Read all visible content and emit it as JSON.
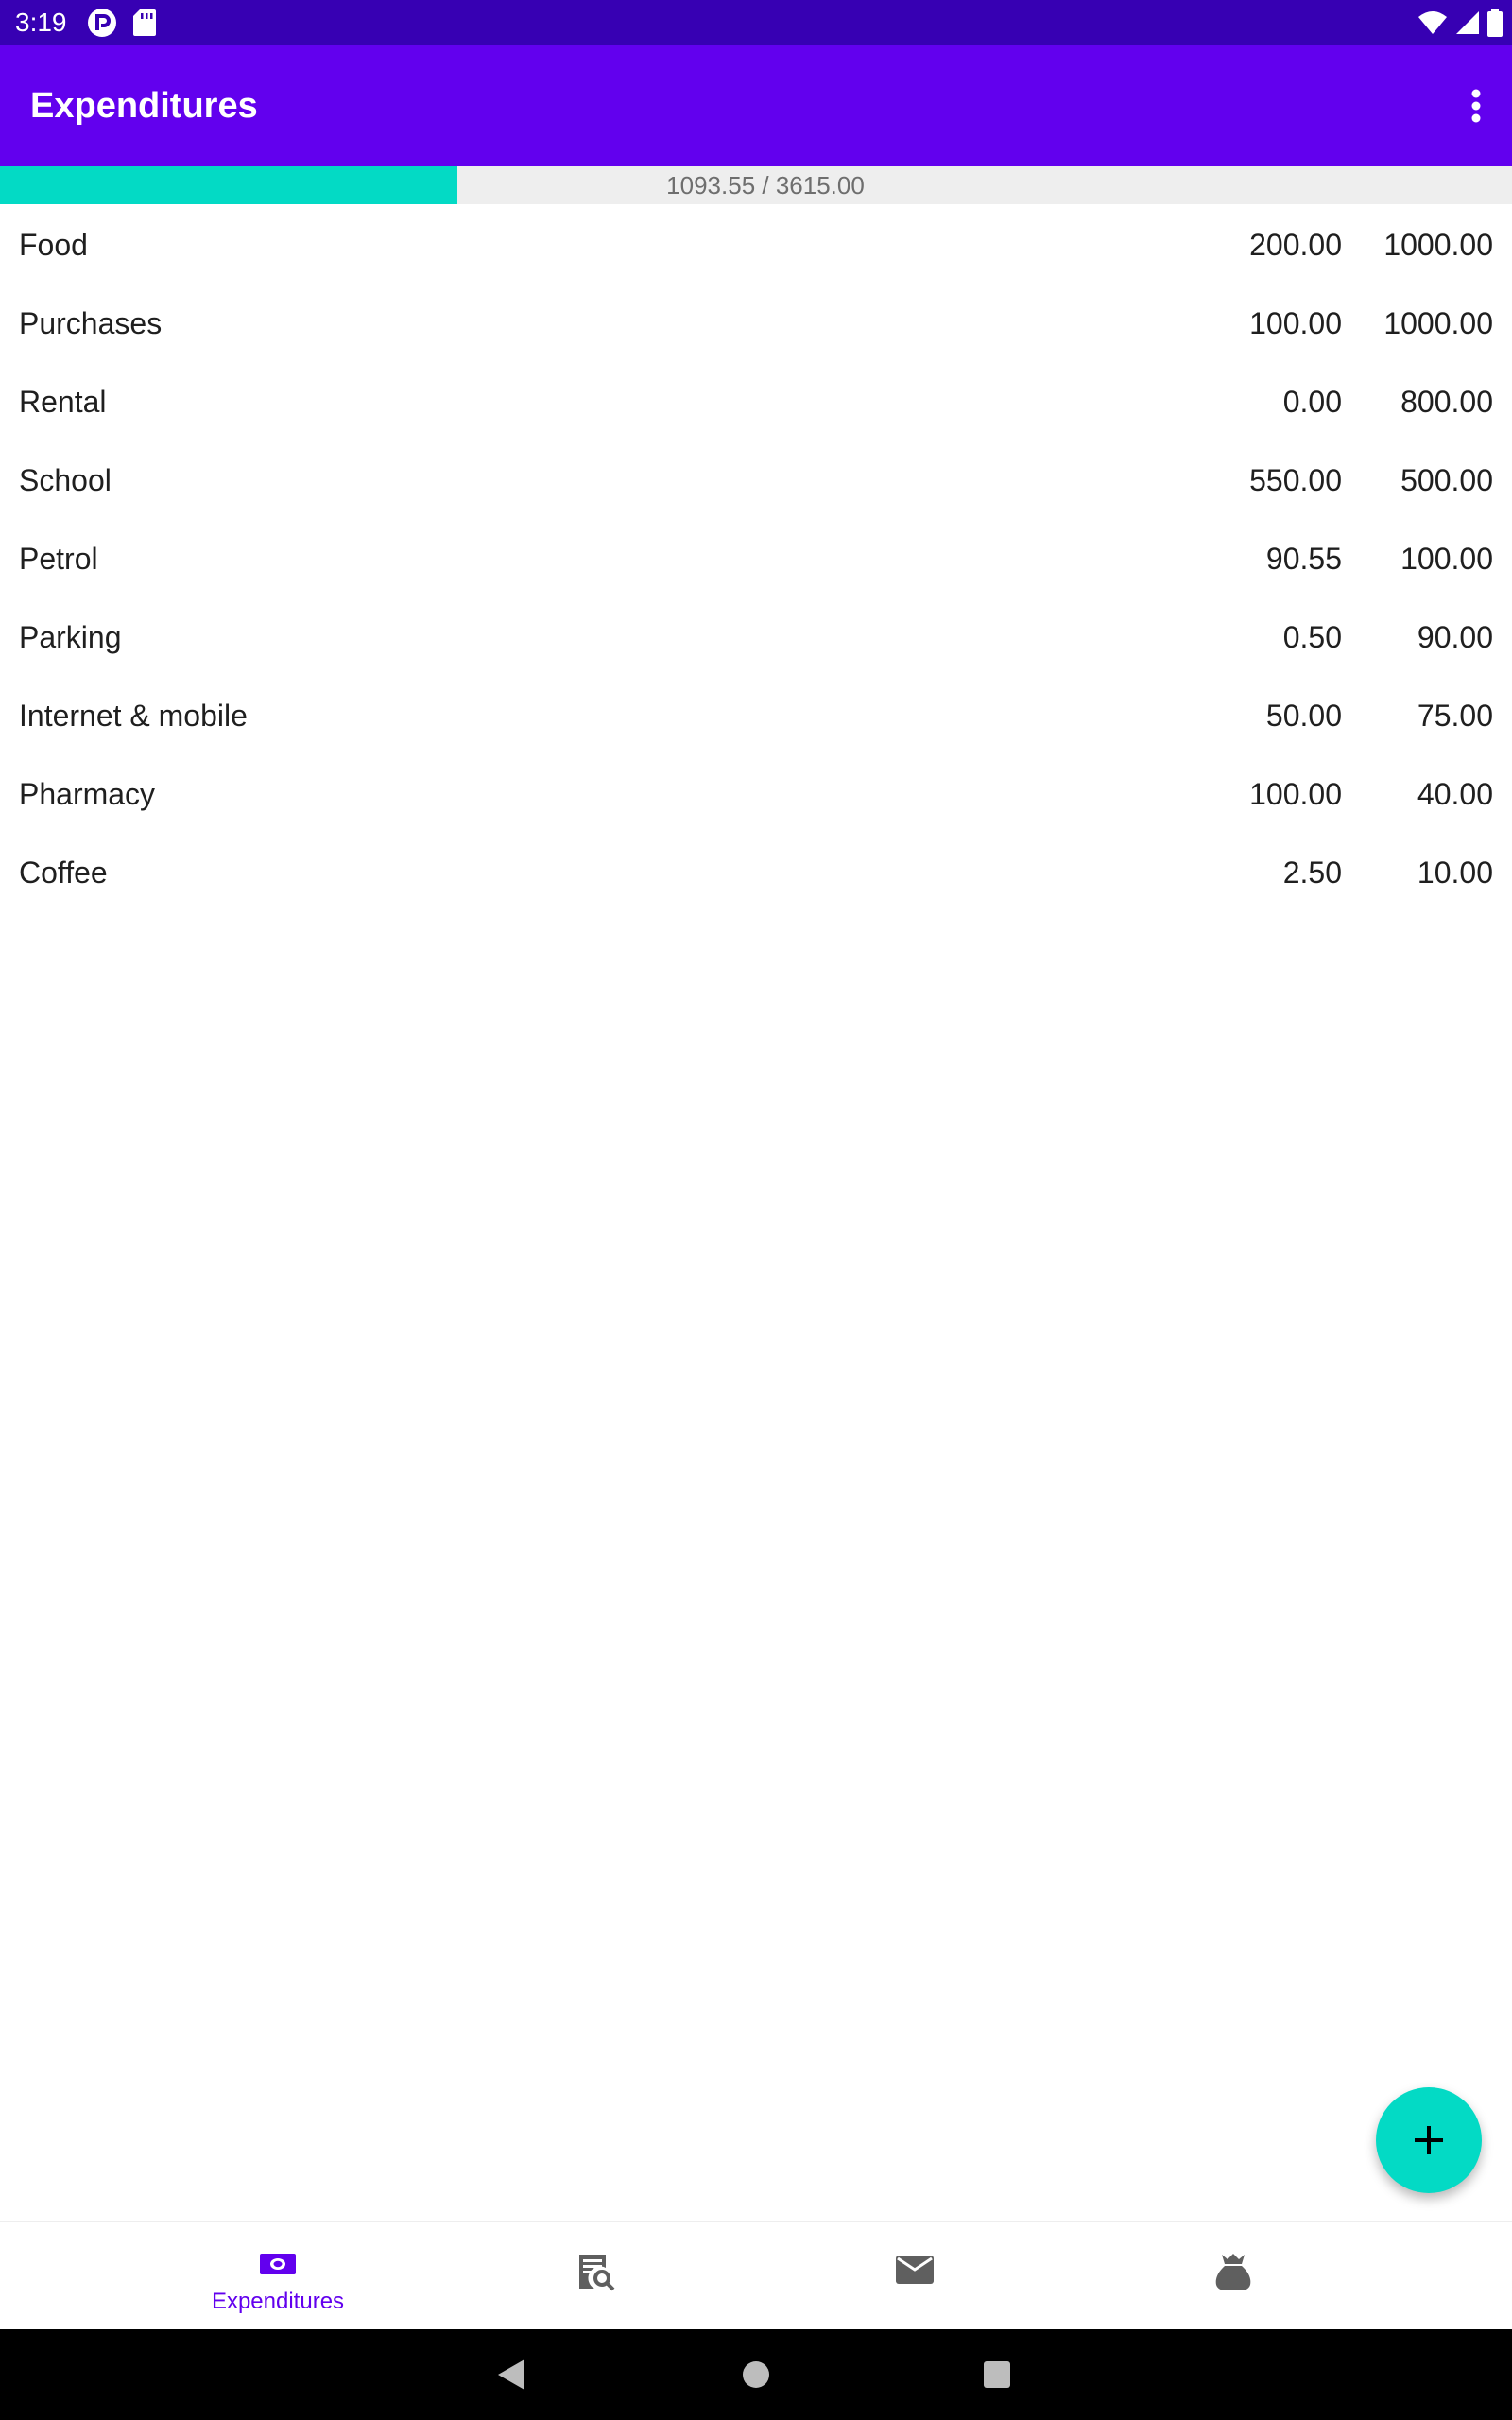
{
  "status_bar": {
    "time": "3:19",
    "left_icons": [
      "pocket-casts-icon",
      "sd-card-icon"
    ],
    "right_icons": [
      "wifi-icon",
      "cellular-signal-icon",
      "battery-icon"
    ]
  },
  "app_bar": {
    "title": "Expenditures",
    "overflow_icon": "more-vert-icon"
  },
  "progress": {
    "label": "1093.55 / 3615.00",
    "fraction": 0.3025,
    "fill_color": "#03dac5",
    "track_color": "#eeeeee"
  },
  "expenditures": [
    {
      "name": "Food",
      "spent": "200.00",
      "budget": "1000.00"
    },
    {
      "name": "Purchases",
      "spent": "100.00",
      "budget": "1000.00"
    },
    {
      "name": "Rental",
      "spent": "0.00",
      "budget": "800.00"
    },
    {
      "name": "School",
      "spent": "550.00",
      "budget": "500.00"
    },
    {
      "name": "Petrol",
      "spent": "90.55",
      "budget": "100.00"
    },
    {
      "name": "Parking",
      "spent": "0.50",
      "budget": "90.00"
    },
    {
      "name": "Internet & mobile",
      "spent": "50.00",
      "budget": "75.00"
    },
    {
      "name": "Pharmacy",
      "spent": "100.00",
      "budget": "40.00"
    },
    {
      "name": "Coffee",
      "spent": "2.50",
      "budget": "10.00"
    }
  ],
  "fab": {
    "icon": "add-icon"
  },
  "bottom_nav": {
    "items": [
      {
        "label": "Expenditures",
        "icon": "money-icon",
        "active": true
      },
      {
        "label": "",
        "icon": "receipt-search-icon",
        "active": false
      },
      {
        "label": "",
        "icon": "mail-icon",
        "active": false
      },
      {
        "label": "",
        "icon": "money-bag-icon",
        "active": false
      }
    ]
  },
  "system_nav": [
    "back-icon",
    "home-icon",
    "recents-icon"
  ],
  "colors": {
    "primary": "#6200ee",
    "primary_dark": "#3700b3",
    "accent": "#03dac5",
    "inactive_icon": "#5f5f5f"
  }
}
